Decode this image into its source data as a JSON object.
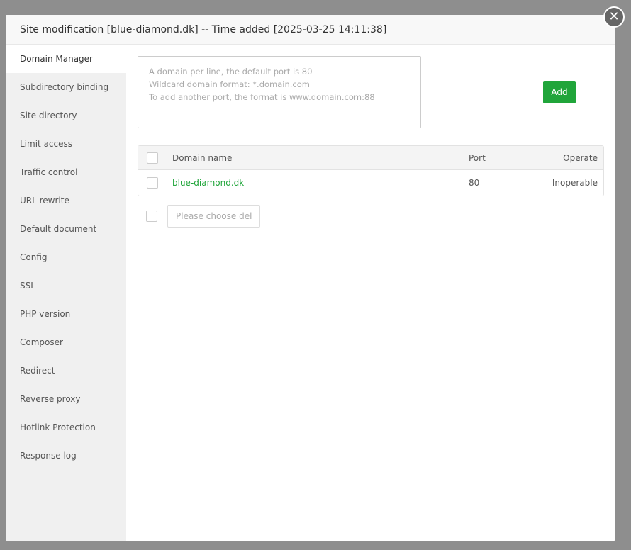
{
  "title": "Site modification [blue-diamond.dk] -- Time added [2025-03-25 14:11:38]",
  "sidebar": [
    "Domain Manager",
    "Subdirectory binding",
    "Site directory",
    "Limit access",
    "Traffic control",
    "URL rewrite",
    "Default document",
    "Config",
    "SSL",
    "PHP version",
    "Composer",
    "Redirect",
    "Reverse proxy",
    "Hotlink Protection",
    "Response log"
  ],
  "textarea_placeholder": "A domain per line, the default port is 80\nWildcard domain format: *.domain.com\nTo add another port, the format is www.domain.com:88",
  "add_label": "Add",
  "table": {
    "headers": [
      "Domain name",
      "Port",
      "Operate"
    ],
    "rows": [
      {
        "domain": "blue-diamond.dk",
        "port": "80",
        "operate": "Inoperable"
      }
    ]
  },
  "delete_label": "Please choose del",
  "accent": "#20a53a"
}
